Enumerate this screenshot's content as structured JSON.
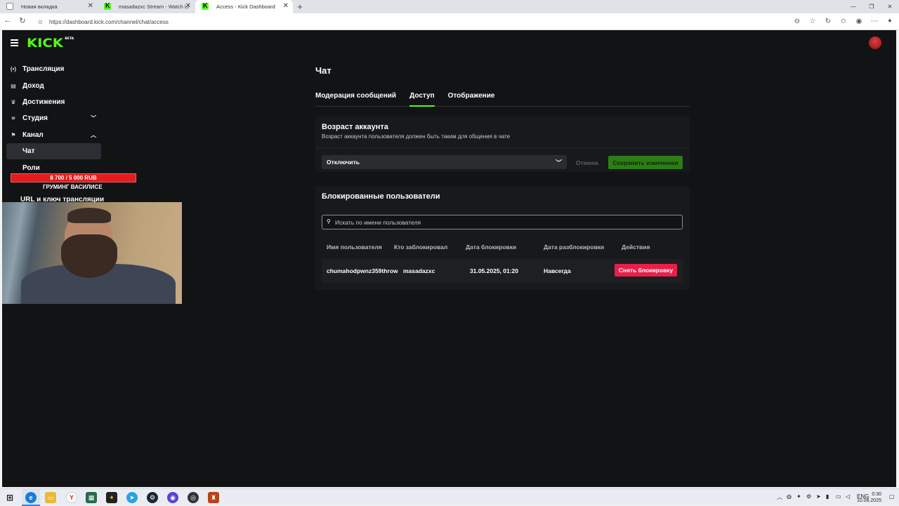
{
  "browser": {
    "tabs": [
      {
        "title": "Новая вкладка",
        "favicon": "blank-page-icon",
        "active": false
      },
      {
        "title": "masadazxc Stream - Watch Live o",
        "favicon": "kick-icon",
        "active": false
      },
      {
        "title": "Access - Kick Dashboard",
        "favicon": "kick-icon",
        "active": true
      }
    ],
    "url": "https://dashboard.kick.com/channel/chat/access"
  },
  "app": {
    "logo": "KICK",
    "logo_badge": "BETA",
    "brand_color": "#53fc18"
  },
  "sidebar": {
    "items": [
      {
        "label": "Трансляция",
        "icon": "broadcast-icon"
      },
      {
        "label": "Доход",
        "icon": "wallet-icon"
      },
      {
        "label": "Достижения",
        "icon": "trophy-icon"
      },
      {
        "label": "Студия",
        "icon": "studio-icon",
        "expand": "chevron-down-icon"
      },
      {
        "label": "Канал",
        "icon": "channel-icon",
        "expand": "chevron-up-icon"
      }
    ],
    "subitems": [
      {
        "label": "Чат",
        "active": true
      },
      {
        "label": "Роли",
        "active": false
      }
    ],
    "url_item": "URL и ключ трансляции"
  },
  "overlay": {
    "donation_goal": "8 700 / 5 000 RUB",
    "donation_caption": "ГРУМИНГ ВАСИЛИСЕ"
  },
  "main": {
    "title": "Чат",
    "tabs": [
      {
        "label": "Модерация сообщений",
        "active": false
      },
      {
        "label": "Доступ",
        "active": true
      },
      {
        "label": "Отображение",
        "active": false
      }
    ],
    "account_age": {
      "title": "Возраст аккаунта",
      "description": "Возраст аккаунта пользователя должен быть таким для общения в чате",
      "selected": "Отключить",
      "cancel_label": "Отмена",
      "save_label": "Сохранить изменения"
    },
    "blocked": {
      "title": "Блокированные пользователи",
      "search_placeholder": "Искать по имени пользователя",
      "columns": [
        "Имя пользователя",
        "Кто заблокировал",
        "Дата блокировки",
        "Дата разблокировки",
        "Действия"
      ],
      "rows": [
        {
          "username": "chumahodpwnz359throw",
          "blocked_by": "masadazxc",
          "blocked_at": "31.05.2025, 01:20",
          "unblock_at": "Навсегда",
          "action_label": "Снять блокировку"
        }
      ]
    }
  },
  "taskbar": {
    "language": "ENG",
    "time": "0:30",
    "date": "10.08.2025"
  }
}
